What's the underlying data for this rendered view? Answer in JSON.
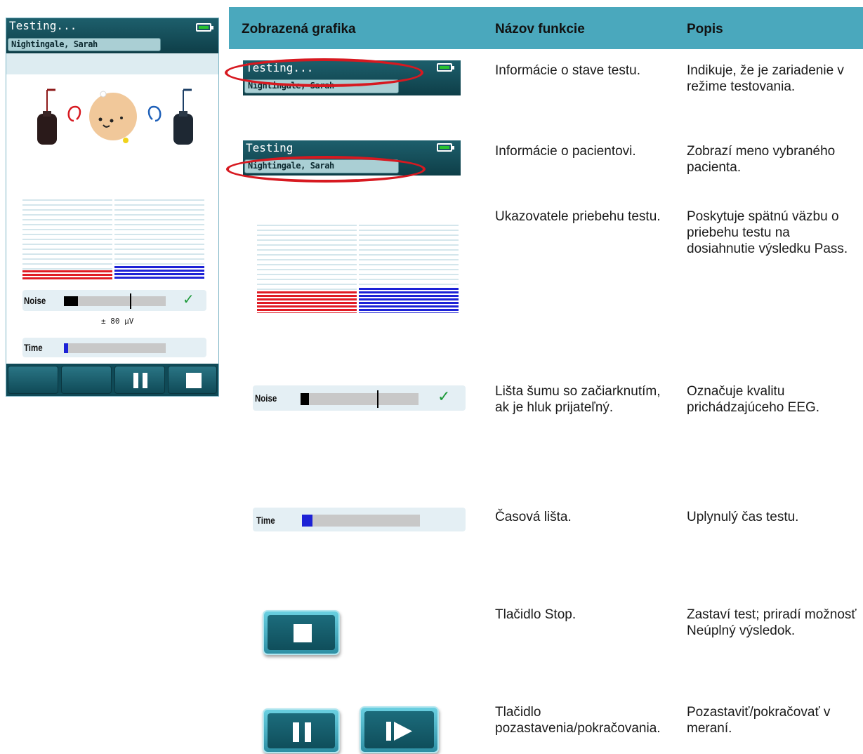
{
  "device": {
    "status_title": "Testing...",
    "patient_name": "Nightingale, Sarah",
    "noise_label": "Noise",
    "noise_value": "± 80 µV",
    "noise_level": 0.1,
    "time_label": "Time",
    "time_progress": 0.04,
    "buttons": [
      "blank-button",
      "blank-button",
      "pause-button",
      "stop-button"
    ]
  },
  "table": {
    "headers": [
      "Zobrazená grafika",
      "Názov funkcie",
      "Popis"
    ],
    "rows": [
      {
        "name": "Informácie o stave testu.",
        "description": "Indikuje, že je zariadenie v režime testovania."
      },
      {
        "name": "Informácie o pacientovi.",
        "description": "Zobrazí meno vybraného pacienta."
      },
      {
        "name": "Ukazovatele priebehu testu.",
        "description": "Poskytuje spätnú väzbu o priebehu testu na dosiahnutie výsledku Pass."
      },
      {
        "name": "Lišta šumu so začiarknutím, ak je hluk prijateľný.",
        "description": "Označuje kvalitu prichádzajúceho EEG."
      },
      {
        "name": "Časová lišta.",
        "description": "Uplynulý čas testu."
      },
      {
        "name": "Tlačidlo Stop.",
        "description": "Zastaví test; priradí možnosť Neúplný výsledok."
      },
      {
        "name": "Tlačidlo pozastavenia/pokračovania.",
        "description": "Pozastaviť/pokračovať v meraní."
      }
    ]
  },
  "graphics": {
    "status_title": "Testing...",
    "status_title_cropped": "Testing",
    "patient_name": "Nightingale, Sarah",
    "noise_label": "Noise",
    "time_label": "Time"
  },
  "colors": {
    "teal_header": "#4aa8bd",
    "screen_header": "#0e3e48",
    "highlight_ring": "#d71920",
    "left_progress": "#e01b24",
    "right_progress": "#1d22d6",
    "ok_check": "#1d9a3a"
  }
}
